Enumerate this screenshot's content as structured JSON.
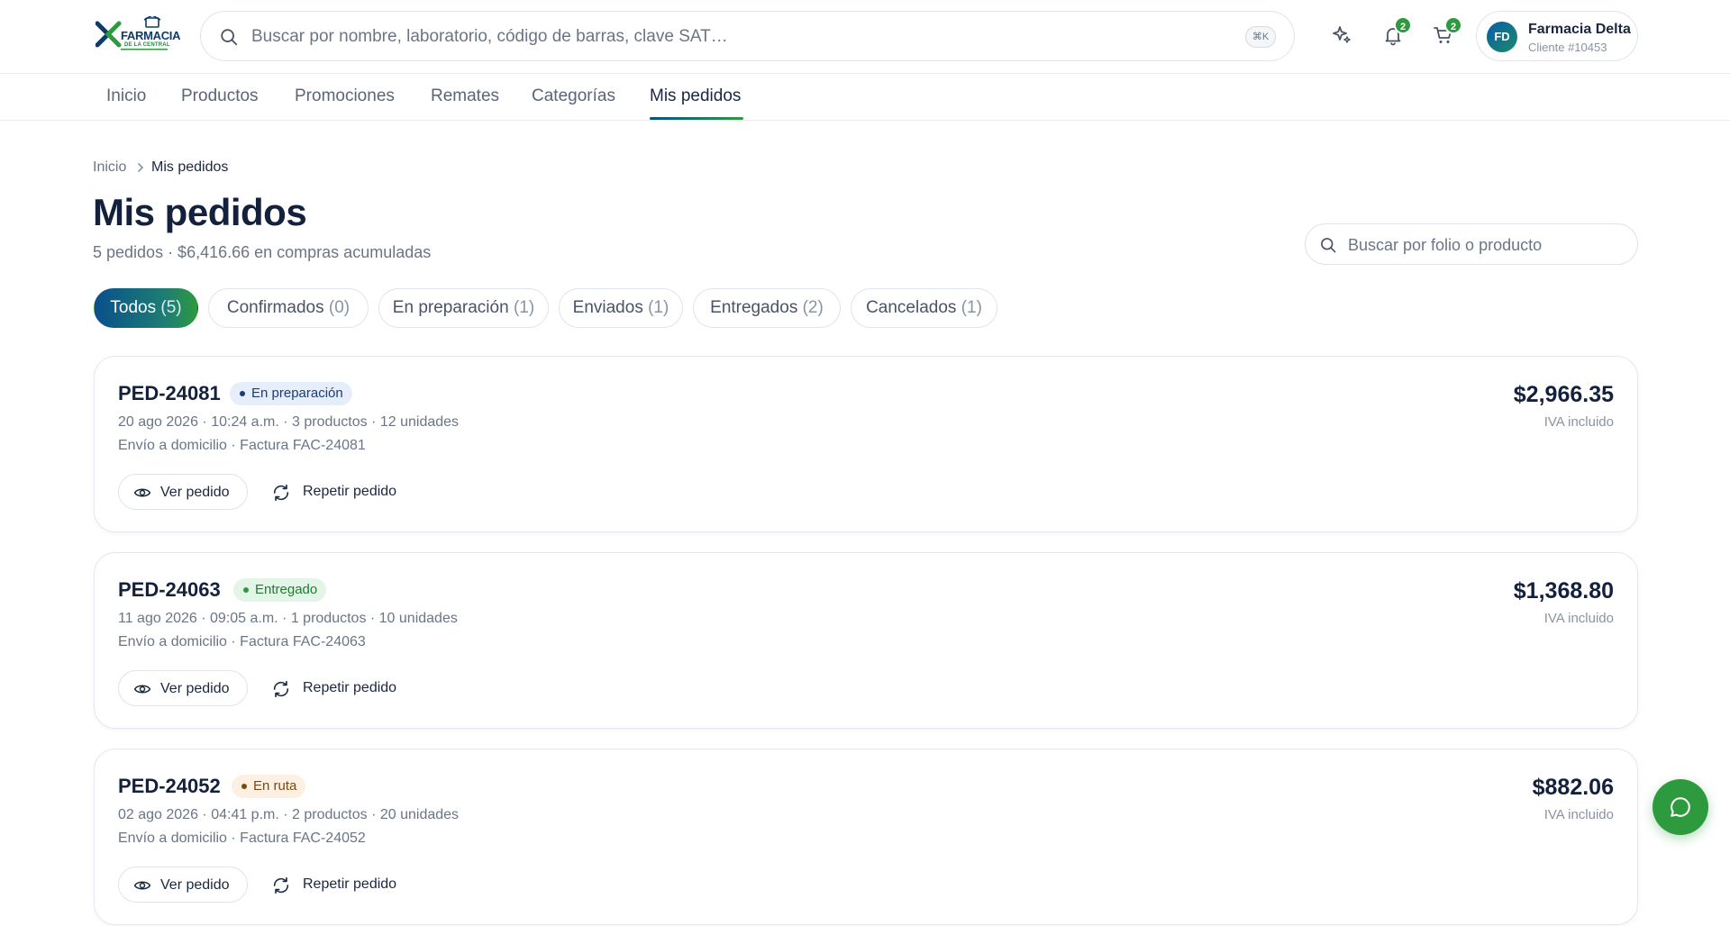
{
  "header": {
    "logo": {
      "line1": "FARMACIA",
      "line2": "DE LA CENTRAL",
      "brand_color": "#0d3b6b",
      "accent": "#2e9a3e"
    },
    "search": {
      "placeholder": "Buscar por nombre, laboratorio, código de barras, clave SAT…",
      "shortcut": "⌘K",
      "icon": "search-icon"
    },
    "icons": {
      "assistant": {
        "icon": "sparkles-icon"
      },
      "notifications": {
        "icon": "bell-icon",
        "badge": "2"
      },
      "cart": {
        "icon": "cart-icon",
        "badge": "2"
      }
    },
    "account": {
      "initials": "FD",
      "name": "Farmacia Delta",
      "subtitle": "Cliente #10453"
    }
  },
  "nav": {
    "items": [
      "Inicio",
      "Productos",
      "Promociones",
      "Remates",
      "Categorías",
      "Mis pedidos"
    ],
    "active": "Mis pedidos"
  },
  "breadcrumb": {
    "home": "Inicio",
    "current": "Mis pedidos"
  },
  "page": {
    "title": "Mis pedidos",
    "summary": "5 pedidos · $6,416.66 en compras acumuladas",
    "folio_search_placeholder": "Buscar por folio o producto"
  },
  "filters": [
    {
      "label": "Todos",
      "count": "(5)",
      "active": true
    },
    {
      "label": "Confirmados",
      "count": "(0)",
      "active": false
    },
    {
      "label": "En preparación",
      "count": "(1)",
      "active": false
    },
    {
      "label": "Enviados",
      "count": "(1)",
      "active": false
    },
    {
      "label": "Entregados",
      "count": "(2)",
      "active": false
    },
    {
      "label": "Cancelados",
      "count": "(1)",
      "active": false
    }
  ],
  "orders": [
    {
      "folio": "PED-24081",
      "status": "En preparación",
      "status_kind": "prep",
      "meta1": "20 ago 2026 · 10:24 a.m. · 3 productos · 12 unidades",
      "meta2": "Envío a domicilio · Factura FAC-24081",
      "total": "$2,966.35",
      "tax_note": "IVA incluido"
    },
    {
      "folio": "PED-24063",
      "status": "Entregado",
      "status_kind": "done",
      "meta1": "11 ago 2026 · 09:05 a.m. · 1 productos · 10 unidades",
      "meta2": "Envío a domicilio · Factura FAC-24063",
      "total": "$1,368.80",
      "tax_note": "IVA incluido"
    },
    {
      "folio": "PED-24052",
      "status": "En ruta",
      "status_kind": "route",
      "meta1": "02 ago 2026 · 04:41 p.m. · 2 productos · 20 unidades",
      "meta2": "Envío a domicilio · Factura FAC-24052",
      "total": "$882.06",
      "tax_note": "IVA incluido"
    }
  ],
  "order_actions": {
    "view": "Ver pedido",
    "repeat": "Repetir pedido"
  },
  "colors": {
    "primary": "#0a4f8c",
    "green": "#2e9a3e",
    "text": "#13213d",
    "muted": "#6b7585"
  },
  "chat": {
    "icon": "chat-bubble-icon"
  }
}
